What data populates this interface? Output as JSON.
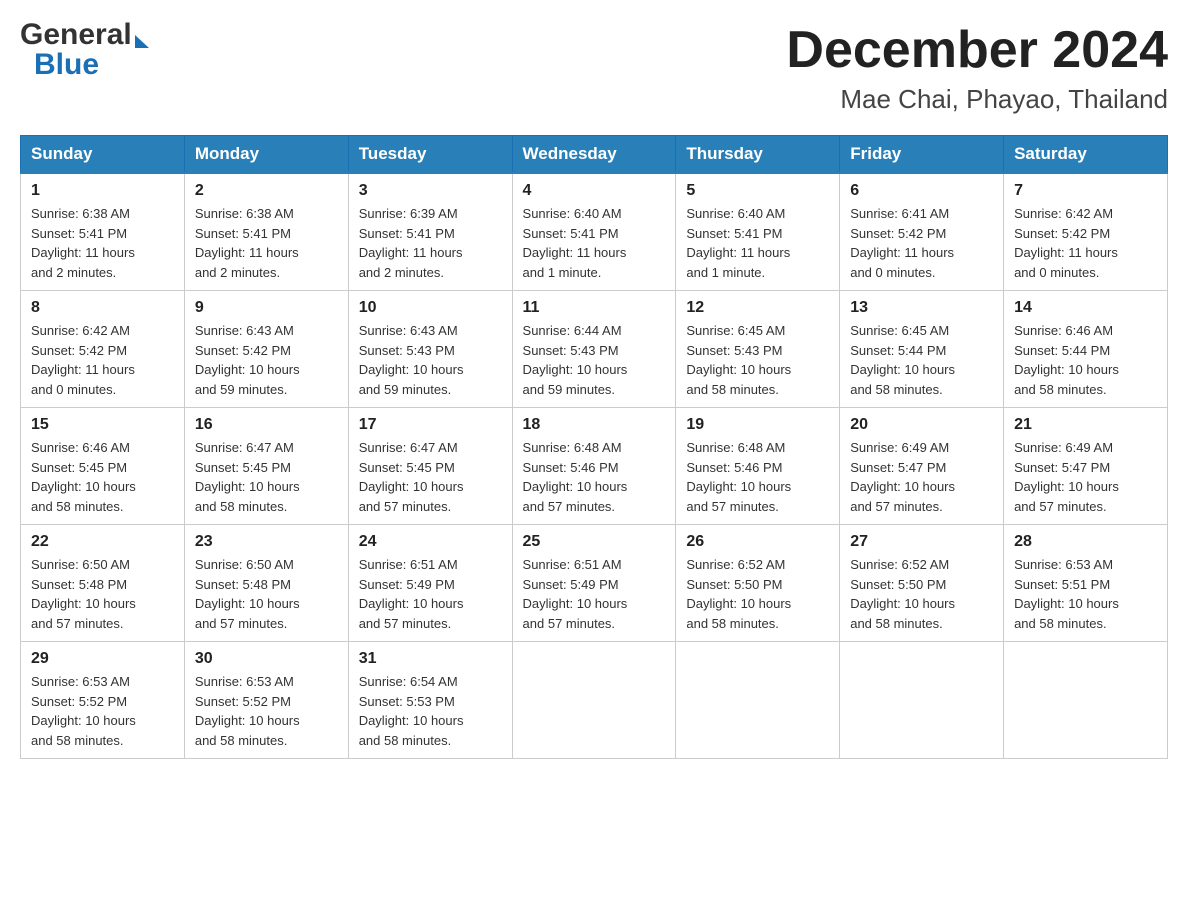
{
  "header": {
    "logo": {
      "general": "General",
      "blue": "Blue"
    },
    "title": "December 2024",
    "location": "Mae Chai, Phayao, Thailand"
  },
  "calendar": {
    "days_of_week": [
      "Sunday",
      "Monday",
      "Tuesday",
      "Wednesday",
      "Thursday",
      "Friday",
      "Saturday"
    ],
    "weeks": [
      [
        {
          "day": "1",
          "sunrise": "6:38 AM",
          "sunset": "5:41 PM",
          "daylight": "11 hours and 2 minutes."
        },
        {
          "day": "2",
          "sunrise": "6:38 AM",
          "sunset": "5:41 PM",
          "daylight": "11 hours and 2 minutes."
        },
        {
          "day": "3",
          "sunrise": "6:39 AM",
          "sunset": "5:41 PM",
          "daylight": "11 hours and 2 minutes."
        },
        {
          "day": "4",
          "sunrise": "6:40 AM",
          "sunset": "5:41 PM",
          "daylight": "11 hours and 1 minute."
        },
        {
          "day": "5",
          "sunrise": "6:40 AM",
          "sunset": "5:41 PM",
          "daylight": "11 hours and 1 minute."
        },
        {
          "day": "6",
          "sunrise": "6:41 AM",
          "sunset": "5:42 PM",
          "daylight": "11 hours and 0 minutes."
        },
        {
          "day": "7",
          "sunrise": "6:42 AM",
          "sunset": "5:42 PM",
          "daylight": "11 hours and 0 minutes."
        }
      ],
      [
        {
          "day": "8",
          "sunrise": "6:42 AM",
          "sunset": "5:42 PM",
          "daylight": "11 hours and 0 minutes."
        },
        {
          "day": "9",
          "sunrise": "6:43 AM",
          "sunset": "5:42 PM",
          "daylight": "10 hours and 59 minutes."
        },
        {
          "day": "10",
          "sunrise": "6:43 AM",
          "sunset": "5:43 PM",
          "daylight": "10 hours and 59 minutes."
        },
        {
          "day": "11",
          "sunrise": "6:44 AM",
          "sunset": "5:43 PM",
          "daylight": "10 hours and 59 minutes."
        },
        {
          "day": "12",
          "sunrise": "6:45 AM",
          "sunset": "5:43 PM",
          "daylight": "10 hours and 58 minutes."
        },
        {
          "day": "13",
          "sunrise": "6:45 AM",
          "sunset": "5:44 PM",
          "daylight": "10 hours and 58 minutes."
        },
        {
          "day": "14",
          "sunrise": "6:46 AM",
          "sunset": "5:44 PM",
          "daylight": "10 hours and 58 minutes."
        }
      ],
      [
        {
          "day": "15",
          "sunrise": "6:46 AM",
          "sunset": "5:45 PM",
          "daylight": "10 hours and 58 minutes."
        },
        {
          "day": "16",
          "sunrise": "6:47 AM",
          "sunset": "5:45 PM",
          "daylight": "10 hours and 58 minutes."
        },
        {
          "day": "17",
          "sunrise": "6:47 AM",
          "sunset": "5:45 PM",
          "daylight": "10 hours and 57 minutes."
        },
        {
          "day": "18",
          "sunrise": "6:48 AM",
          "sunset": "5:46 PM",
          "daylight": "10 hours and 57 minutes."
        },
        {
          "day": "19",
          "sunrise": "6:48 AM",
          "sunset": "5:46 PM",
          "daylight": "10 hours and 57 minutes."
        },
        {
          "day": "20",
          "sunrise": "6:49 AM",
          "sunset": "5:47 PM",
          "daylight": "10 hours and 57 minutes."
        },
        {
          "day": "21",
          "sunrise": "6:49 AM",
          "sunset": "5:47 PM",
          "daylight": "10 hours and 57 minutes."
        }
      ],
      [
        {
          "day": "22",
          "sunrise": "6:50 AM",
          "sunset": "5:48 PM",
          "daylight": "10 hours and 57 minutes."
        },
        {
          "day": "23",
          "sunrise": "6:50 AM",
          "sunset": "5:48 PM",
          "daylight": "10 hours and 57 minutes."
        },
        {
          "day": "24",
          "sunrise": "6:51 AM",
          "sunset": "5:49 PM",
          "daylight": "10 hours and 57 minutes."
        },
        {
          "day": "25",
          "sunrise": "6:51 AM",
          "sunset": "5:49 PM",
          "daylight": "10 hours and 57 minutes."
        },
        {
          "day": "26",
          "sunrise": "6:52 AM",
          "sunset": "5:50 PM",
          "daylight": "10 hours and 58 minutes."
        },
        {
          "day": "27",
          "sunrise": "6:52 AM",
          "sunset": "5:50 PM",
          "daylight": "10 hours and 58 minutes."
        },
        {
          "day": "28",
          "sunrise": "6:53 AM",
          "sunset": "5:51 PM",
          "daylight": "10 hours and 58 minutes."
        }
      ],
      [
        {
          "day": "29",
          "sunrise": "6:53 AM",
          "sunset": "5:52 PM",
          "daylight": "10 hours and 58 minutes."
        },
        {
          "day": "30",
          "sunrise": "6:53 AM",
          "sunset": "5:52 PM",
          "daylight": "10 hours and 58 minutes."
        },
        {
          "day": "31",
          "sunrise": "6:54 AM",
          "sunset": "5:53 PM",
          "daylight": "10 hours and 58 minutes."
        },
        null,
        null,
        null,
        null
      ]
    ]
  }
}
